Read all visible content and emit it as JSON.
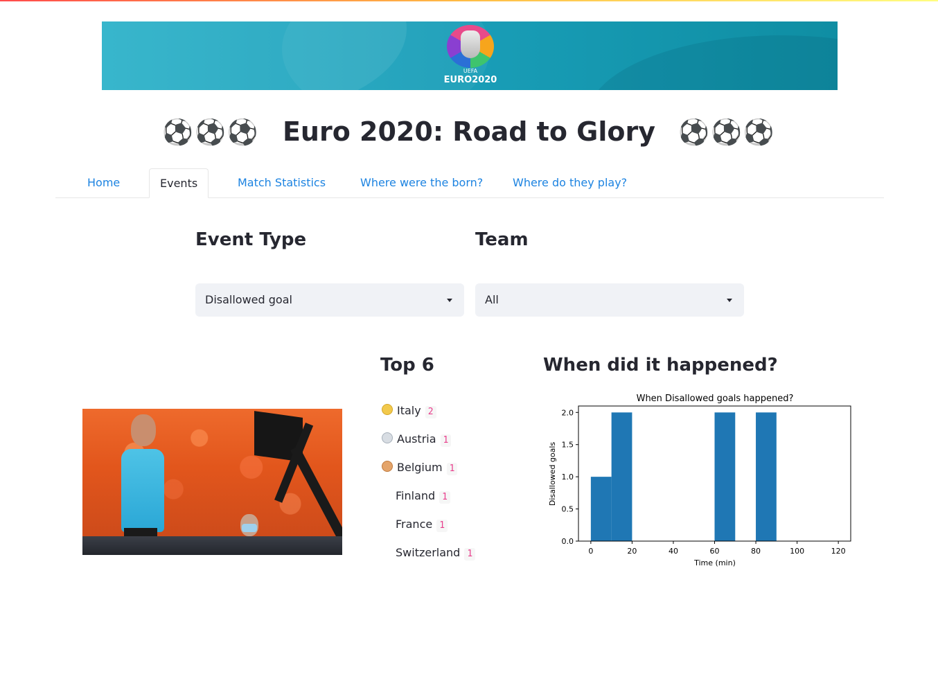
{
  "page": {
    "title": "Euro 2020: Road to Glory",
    "title_decoration": "⚽⚽⚽"
  },
  "banner": {
    "logo_uefa": "UEFA",
    "logo_text": "EURO2020"
  },
  "tabs": [
    {
      "label": "Home",
      "active": false
    },
    {
      "label": "Events",
      "active": true
    },
    {
      "label": "Match Statistics",
      "active": false
    },
    {
      "label": "Where were the born?",
      "active": false
    },
    {
      "label": "Where do they play?",
      "active": false
    }
  ],
  "filters": {
    "event_type": {
      "label": "Event Type",
      "value": "Disallowed goal"
    },
    "team": {
      "label": "Team",
      "value": "All"
    }
  },
  "top": {
    "heading": "Top 6",
    "items": [
      {
        "team": "Italy",
        "count": "2",
        "medal": "gold"
      },
      {
        "team": "Austria",
        "count": "1",
        "medal": "silver"
      },
      {
        "team": "Belgium",
        "count": "1",
        "medal": "bronze"
      },
      {
        "team": "Finland",
        "count": "1",
        "medal": ""
      },
      {
        "team": "France",
        "count": "1",
        "medal": ""
      },
      {
        "team": "Switzerland",
        "count": "1",
        "medal": ""
      }
    ]
  },
  "when": {
    "heading": "When did it happened?"
  },
  "chart_data": {
    "type": "bar",
    "title": "When Disallowed goals happened?",
    "xlabel": "Time (min)",
    "ylabel": "Disallowed goals",
    "bins": [
      [
        0,
        10
      ],
      [
        10,
        20
      ],
      [
        60,
        70
      ],
      [
        80,
        90
      ]
    ],
    "values": [
      1,
      2,
      2,
      2
    ],
    "xlim": [
      -6,
      126
    ],
    "ylim": [
      0,
      2.1
    ],
    "xticks": [
      0,
      20,
      40,
      60,
      80,
      100,
      120
    ],
    "yticks": [
      0.0,
      0.5,
      1.0,
      1.5,
      2.0
    ],
    "ytick_labels": [
      "0.0",
      "0.5",
      "1.0",
      "1.5",
      "2.0"
    ],
    "color": "#1f77b4",
    "grid": false
  },
  "colors": {
    "accent": "#1c83e1",
    "text": "#262730",
    "select_bg": "#f0f2f6"
  }
}
